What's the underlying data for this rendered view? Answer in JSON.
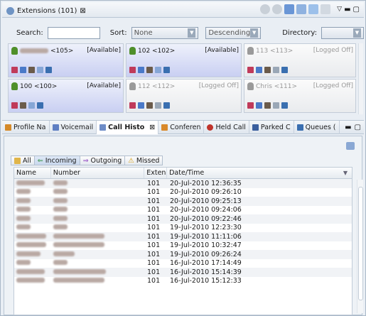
{
  "top_view": {
    "title": "Extensions (101)",
    "close_glyph": "⊠",
    "search_label": "Search:",
    "search_value": "",
    "sort_label": "Sort:",
    "sort_value": "None",
    "order_value": "Descending",
    "directory_label": "Directory:",
    "directory_value": ""
  },
  "extensions": [
    {
      "name_visible": "<105>",
      "status": "[Available]",
      "state": "available",
      "icon_color": "#4f8f2a"
    },
    {
      "name_visible": "102 <102>",
      "status": "[Available]",
      "state": "available",
      "icon_color": "#4f8f2a"
    },
    {
      "name_visible": "113 <113>",
      "status": "[Logged Off]",
      "state": "off",
      "icon_color": "#9a9a9a"
    },
    {
      "name_visible": "100 <100>",
      "status": "[Available]",
      "state": "available",
      "icon_color": "#4f8f2a"
    },
    {
      "name_visible": "112 <112>",
      "status": "[Logged Off]",
      "state": "off",
      "icon_color": "#9a9a9a"
    },
    {
      "name_visible": "Chris <111>",
      "status": "[Logged Off]",
      "state": "off",
      "icon_color": "#9a9a9a"
    }
  ],
  "bottom_tabs": [
    {
      "label": "Profile Na",
      "active": false,
      "icon_color": "#d58a2a"
    },
    {
      "label": "Voicemail",
      "active": false,
      "icon_color": "#5f7fc3"
    },
    {
      "label": "Call Histo",
      "active": true,
      "icon_color": "#6d8cc7"
    },
    {
      "label": "Conferen",
      "active": false,
      "icon_color": "#d9892a"
    },
    {
      "label": "Held Call",
      "active": false,
      "icon_color": "#c0342b"
    },
    {
      "label": "Parked C",
      "active": false,
      "icon_color": "#3a5f9e"
    },
    {
      "label": "Queues (",
      "active": false,
      "icon_color": "#3a6fb0"
    }
  ],
  "filters": [
    {
      "label": "All",
      "active": false
    },
    {
      "label": "Incoming",
      "active": true
    },
    {
      "label": "Outgoing",
      "active": false
    },
    {
      "label": "Missed",
      "active": false
    }
  ],
  "table": {
    "columns": [
      "Name",
      "Number",
      "Exten",
      "Date/Time"
    ],
    "rows": [
      {
        "exten": "101",
        "datetime": "20-Jul-2010 12:36:35"
      },
      {
        "exten": "101",
        "datetime": "20-Jul-2010 09:26:10"
      },
      {
        "exten": "101",
        "datetime": "20-Jul-2010 09:25:13"
      },
      {
        "exten": "101",
        "datetime": "20-Jul-2010 09:24:06"
      },
      {
        "exten": "101",
        "datetime": "20-Jul-2010 09:22:46"
      },
      {
        "exten": "101",
        "datetime": "19-Jul-2010 12:23:30"
      },
      {
        "exten": "101",
        "datetime": "19-Jul-2010 11:11:06"
      },
      {
        "exten": "101",
        "datetime": "19-Jul-2010 10:32:47"
      },
      {
        "exten": "101",
        "datetime": "19-Jul-2010 09:26:24"
      },
      {
        "exten": "101",
        "datetime": "16-Jul-2010 17:14:49"
      },
      {
        "exten": "101",
        "datetime": "16-Jul-2010 15:14:39"
      },
      {
        "exten": "101",
        "datetime": "16-Jul-2010 15:12:33"
      }
    ]
  }
}
